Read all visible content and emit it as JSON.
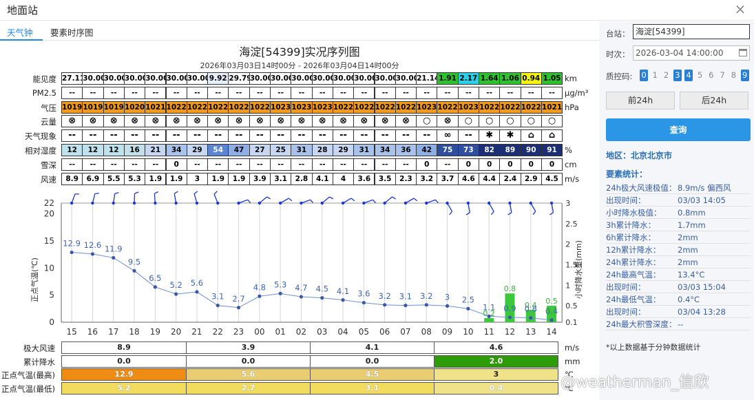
{
  "window": {
    "title": "地面站",
    "close": "×"
  },
  "tabs": [
    "天气钟",
    "要素时序图"
  ],
  "title": "海淀[54399]实况序列图",
  "subtitle": "2026年03月03日14时00分 - 2026年03月04日14时00分",
  "hours": [
    "15",
    "16",
    "17",
    "18",
    "19",
    "20",
    "21",
    "22",
    "23",
    "00",
    "01",
    "02",
    "03",
    "04",
    "05",
    "06",
    "07",
    "08",
    "09",
    "10",
    "11",
    "12",
    "13",
    "14"
  ],
  "table_rows": [
    {
      "label": "能见度",
      "unit": "km",
      "values": [
        "27.11",
        "30.00",
        "30.00",
        "30.00",
        "30.00",
        "30.00",
        "30.00",
        "9.92",
        "29.79",
        "30.00",
        "30.00",
        "30.00",
        "30.00",
        "30.00",
        "30.00",
        "30.00",
        "30.00",
        "21.14",
        "1.91",
        "2.17",
        "1.64",
        "1.06",
        "0.94",
        "1.05"
      ]
    },
    {
      "label": "PM2.5",
      "unit": "μg/m³",
      "values": [
        "--",
        "--",
        "--",
        "--",
        "--",
        "--",
        "--",
        "--",
        "--",
        "--",
        "--",
        "--",
        "--",
        "--",
        "--",
        "--",
        "--",
        "--",
        "--",
        "--",
        "--",
        "--",
        "--",
        "--"
      ]
    },
    {
      "label": "气压",
      "unit": "hPa",
      "values": [
        "1019",
        "1019",
        "1019",
        "1020",
        "1021",
        "1022",
        "1022",
        "1022",
        "1022",
        "1022",
        "1023",
        "1023",
        "1023",
        "1022",
        "1022",
        "1022",
        "1022",
        "1023",
        "1022",
        "1023",
        "1022",
        "1022",
        "1022",
        "1021"
      ]
    },
    {
      "label": "云量",
      "unit": "",
      "values": [
        "⊗",
        "⊗",
        "⊗",
        "⊗",
        "⊗",
        "⊗",
        "⊗",
        "⊗",
        "⊗",
        "⊗",
        "⊗",
        "⊗",
        "⊗",
        "⊗",
        "⊗",
        "⊗",
        "⊗",
        "○",
        "⊗",
        "○",
        "○",
        "○",
        "○",
        "○"
      ]
    },
    {
      "label": "天气现象",
      "unit": "",
      "values": [
        "--",
        "--",
        "--",
        "--",
        "--",
        "--",
        "--",
        "--",
        "--",
        "--",
        "--",
        "--",
        "--",
        "--",
        "--",
        "--",
        "--",
        "--",
        "∞",
        "--",
        "✱",
        "✱",
        "⌂",
        "⌂"
      ]
    },
    {
      "label": "相对湿度",
      "unit": "%",
      "values": [
        "12",
        "12",
        "12",
        "16",
        "21",
        "34",
        "29",
        "54",
        "47",
        "27",
        "25",
        "31",
        "28",
        "29",
        "31",
        "34",
        "36",
        "42",
        "75",
        "73",
        "82",
        "89",
        "90",
        "91"
      ]
    },
    {
      "label": "雪深",
      "unit": "cm",
      "values": [
        "--",
        "--",
        "--",
        "--",
        "--",
        "0",
        "--",
        "--",
        "--",
        "--",
        "--",
        "--",
        "--",
        "--",
        "--",
        "--",
        "--",
        "0",
        "--",
        "0",
        "0",
        "0",
        "0",
        "0"
      ]
    },
    {
      "label": "风速",
      "unit": "m/s",
      "values": [
        "8.9",
        "6.9",
        "5.5",
        "5.3",
        "1.9",
        "1.9",
        "3",
        "1.9",
        "1.9",
        "3.9",
        "3.1",
        "2.8",
        "4.1",
        "4",
        "3.6",
        "3.5",
        "2.3",
        "3.2",
        "3.7",
        "4.6",
        "4.4",
        "2.4",
        "2.9",
        "4.5"
      ]
    }
  ],
  "cell_colors": {
    "white": "#ffffff",
    "vis_green": "#2ec22e",
    "vis_cyan": "#2ad0e8",
    "vis_yellow": "#f5f50a",
    "pressure": "#f29a1c"
  },
  "chart_data": {
    "type": "line",
    "x": [
      "15",
      "16",
      "17",
      "18",
      "19",
      "20",
      "21",
      "22",
      "23",
      "00",
      "01",
      "02",
      "03",
      "04",
      "05",
      "06",
      "07",
      "08",
      "09",
      "10",
      "11",
      "12",
      "13",
      "14"
    ],
    "series": [
      {
        "name": "正点气温(℃)",
        "values": [
          12.9,
          12.6,
          11.9,
          9.5,
          6.5,
          5.2,
          5.6,
          3.1,
          2.7,
          4.8,
          5.3,
          4.7,
          4.5,
          4.1,
          3.6,
          3.2,
          3.1,
          3.2,
          3,
          2.5,
          1.1,
          0.9,
          0.8,
          0.4
        ],
        "color": "#3a66b8"
      },
      {
        "name": "小时降水量(mm)",
        "type": "bar",
        "values": [
          0,
          0,
          0,
          0,
          0,
          0,
          0,
          0,
          0,
          0,
          0,
          0,
          0,
          0,
          0,
          0,
          0,
          0,
          0,
          0,
          0.2,
          0.8,
          0.4,
          0.5
        ],
        "color": "#3cc73c"
      }
    ],
    "ylabel": "正点气温(℃)",
    "y2label": "小时降水量(mm)",
    "ylim": [
      0,
      22
    ],
    "y_ticks": [
      0,
      5,
      10,
      15,
      20,
      22
    ],
    "y2lim": [
      0.1,
      3
    ],
    "y2_ticks": [
      0.1,
      0.5,
      1,
      1.5,
      2,
      2.5,
      3
    ]
  },
  "summary_rows": [
    {
      "label": "极大风速",
      "unit": "m/s",
      "values": [
        "8.9",
        "3.9",
        "4.1",
        "4.6"
      ]
    },
    {
      "label": "累计降水",
      "unit": "mm",
      "values": [
        "0.0",
        "0.0",
        "0.0",
        "2.0"
      ]
    },
    {
      "label": "正点气温(最高)",
      "unit": "℃",
      "values": [
        "12.9",
        "5.6",
        "4.5",
        "3"
      ]
    },
    {
      "label": "正点气温(最低)",
      "unit": "℃",
      "values": [
        "5.2",
        "2.7",
        "3.1",
        "0.4"
      ]
    }
  ],
  "summary_colors": {
    "rain": "#2e9b08",
    "orange": "#ef8c14",
    "tan": "#e9cd72",
    "yellow": "#f2dc5e",
    "light": "#efe289"
  },
  "sidebar": {
    "station_label": "台站：",
    "station_value": "海淀[54399]",
    "time_label": "时次：",
    "time_value": "2026-03-04 14:00:00",
    "qc_label": "质控码:",
    "qc": [
      "0",
      "1",
      "2",
      "3",
      "4",
      "5",
      "6",
      "7",
      "8",
      "9"
    ],
    "prev": "前24h",
    "next": "后24h",
    "query": "查询",
    "region": "地区：北京北京市",
    "stats_title": "要素统计：",
    "stats": [
      [
        "24h极大风速极值：",
        "8.9m/s 偏西风"
      ],
      [
        "出现时间：",
        "03/03 14:05"
      ],
      [
        "小时降水极值：",
        "0.8mm"
      ],
      [
        "3h累计降水：",
        "1.7mm"
      ],
      [
        "6h累计降水：",
        "2mm"
      ],
      [
        "12h累计降水：",
        "2mm"
      ],
      [
        "24h累计降水：",
        "2mm"
      ],
      [
        "24h最高气温：",
        "13.4°C"
      ],
      [
        "出现时间：",
        "03/03 15:04"
      ],
      [
        "24h最低气温：",
        "0.4°C"
      ],
      [
        "出现时间：",
        "03/04 13:28"
      ],
      [
        "24h最大积雪深度：",
        "--"
      ]
    ],
    "note": "*以上数据基于分钟数据统计"
  },
  "watermark": "@weatherman_信欣"
}
